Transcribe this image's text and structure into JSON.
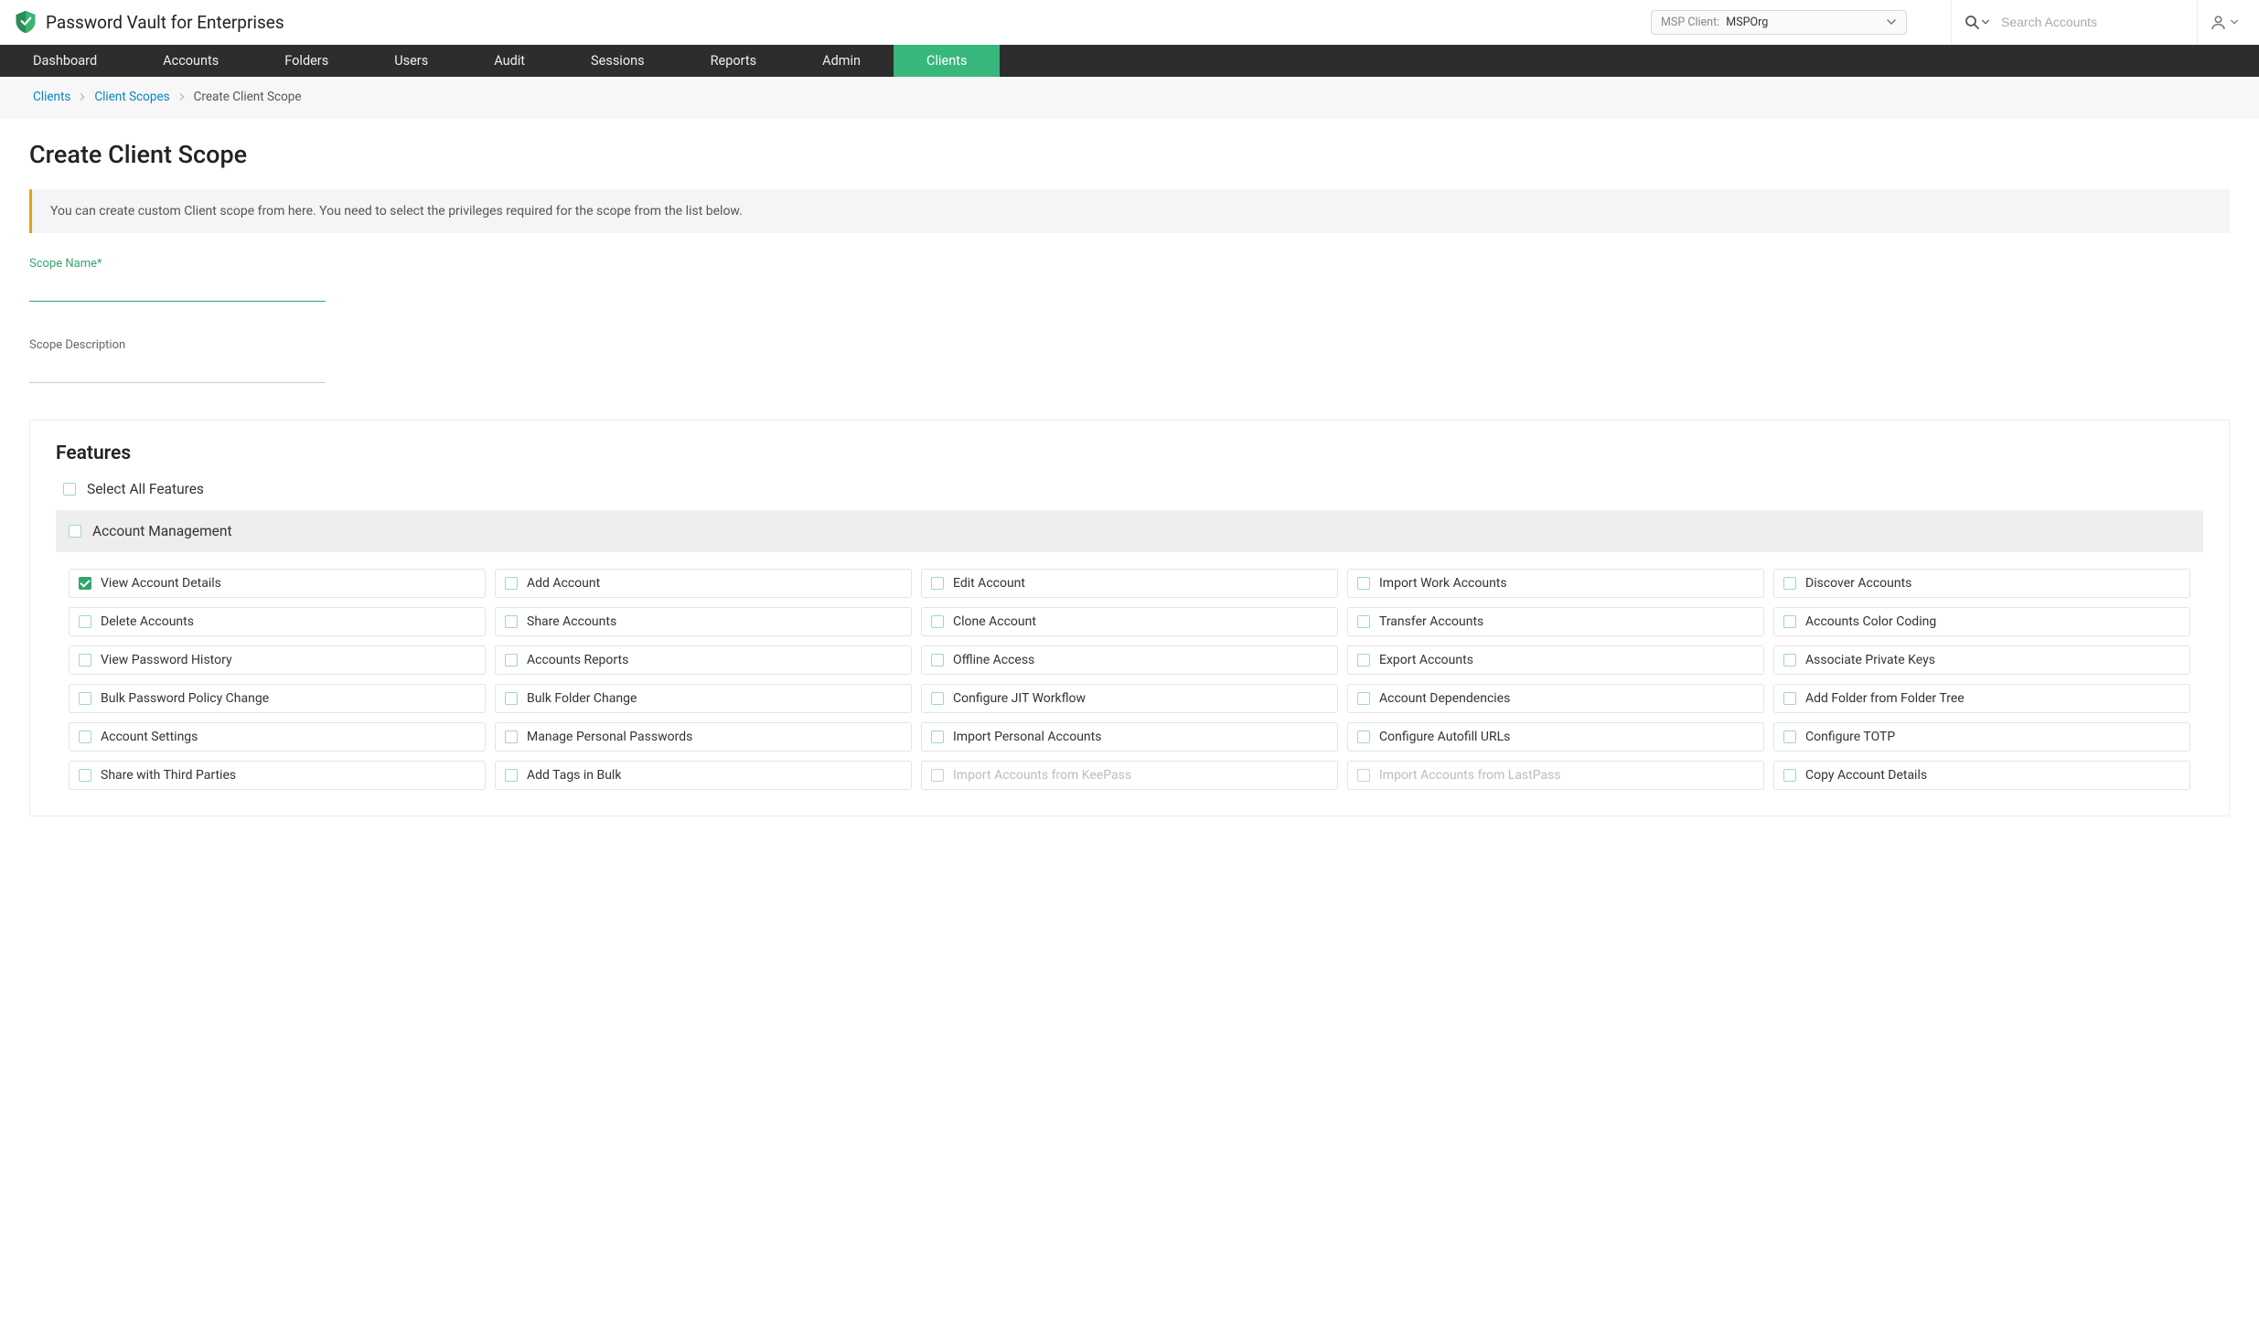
{
  "header": {
    "app_title": "Password Vault for Enterprises",
    "msp_client_label": "MSP Client:",
    "msp_client_value": "MSPOrg",
    "search_placeholder": "Search Accounts"
  },
  "nav": {
    "items": [
      {
        "label": "Dashboard",
        "active": false
      },
      {
        "label": "Accounts",
        "active": false
      },
      {
        "label": "Folders",
        "active": false
      },
      {
        "label": "Users",
        "active": false
      },
      {
        "label": "Audit",
        "active": false
      },
      {
        "label": "Sessions",
        "active": false
      },
      {
        "label": "Reports",
        "active": false
      },
      {
        "label": "Admin",
        "active": false
      },
      {
        "label": "Clients",
        "active": true
      }
    ]
  },
  "breadcrumb": {
    "items": [
      {
        "label": "Clients",
        "link": true
      },
      {
        "label": "Client Scopes",
        "link": true
      },
      {
        "label": "Create Client Scope",
        "link": false
      }
    ]
  },
  "page": {
    "title": "Create Client Scope",
    "info": "You can create custom Client scope from here. You need to select the privileges required for the scope from the list below.",
    "scope_name_label": "Scope Name*",
    "scope_name_value": "",
    "scope_desc_label": "Scope Description",
    "scope_desc_value": ""
  },
  "features": {
    "heading": "Features",
    "select_all_label": "Select All Features",
    "group_label": "Account Management",
    "items": [
      {
        "label": "View Account Details",
        "checked": true,
        "disabled": false
      },
      {
        "label": "Add Account",
        "checked": false,
        "disabled": false
      },
      {
        "label": "Edit Account",
        "checked": false,
        "disabled": false
      },
      {
        "label": "Import Work Accounts",
        "checked": false,
        "disabled": false
      },
      {
        "label": "Discover Accounts",
        "checked": false,
        "disabled": false
      },
      {
        "label": "Delete Accounts",
        "checked": false,
        "disabled": false
      },
      {
        "label": "Share Accounts",
        "checked": false,
        "disabled": false
      },
      {
        "label": "Clone Account",
        "checked": false,
        "disabled": false
      },
      {
        "label": "Transfer Accounts",
        "checked": false,
        "disabled": false
      },
      {
        "label": "Accounts Color Coding",
        "checked": false,
        "disabled": false
      },
      {
        "label": "View Password History",
        "checked": false,
        "disabled": false
      },
      {
        "label": "Accounts Reports",
        "checked": false,
        "disabled": false
      },
      {
        "label": "Offline Access",
        "checked": false,
        "disabled": false
      },
      {
        "label": "Export Accounts",
        "checked": false,
        "disabled": false
      },
      {
        "label": "Associate Private Keys",
        "checked": false,
        "disabled": false
      },
      {
        "label": "Bulk Password Policy Change",
        "checked": false,
        "disabled": false
      },
      {
        "label": "Bulk Folder Change",
        "checked": false,
        "disabled": false
      },
      {
        "label": "Configure JIT Workflow",
        "checked": false,
        "disabled": false
      },
      {
        "label": "Account Dependencies",
        "checked": false,
        "disabled": false
      },
      {
        "label": "Add Folder from Folder Tree",
        "checked": false,
        "disabled": false
      },
      {
        "label": "Account Settings",
        "checked": false,
        "disabled": false
      },
      {
        "label": "Manage Personal Passwords",
        "checked": false,
        "disabled": false
      },
      {
        "label": "Import Personal Accounts",
        "checked": false,
        "disabled": false
      },
      {
        "label": "Configure Autofill URLs",
        "checked": false,
        "disabled": false
      },
      {
        "label": "Configure TOTP",
        "checked": false,
        "disabled": false
      },
      {
        "label": "Share with Third Parties",
        "checked": false,
        "disabled": false
      },
      {
        "label": "Add Tags in Bulk",
        "checked": false,
        "disabled": false
      },
      {
        "label": "Import Accounts from KeePass",
        "checked": false,
        "disabled": true
      },
      {
        "label": "Import Accounts from LastPass",
        "checked": false,
        "disabled": true
      },
      {
        "label": "Copy Account Details",
        "checked": false,
        "disabled": false
      }
    ]
  }
}
